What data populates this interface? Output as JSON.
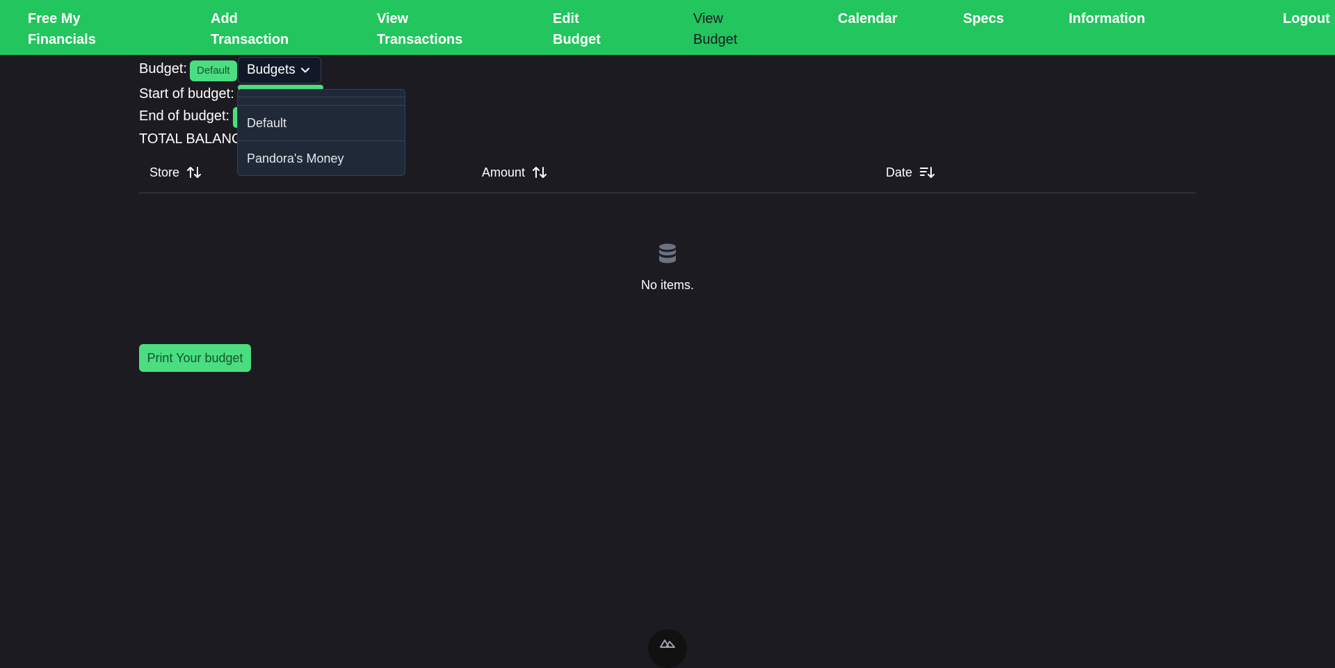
{
  "nav": {
    "brand": "Free My\nFinancials",
    "items": [
      "Add\nTransaction",
      "View\nTransactions",
      "Edit\nBudget",
      "View\nBudget",
      "Calendar",
      "Specs",
      "Information"
    ],
    "logout": "Logout"
  },
  "budget": {
    "label": "Budget:",
    "current": "Default",
    "dropdown_label": "Budgets",
    "options": [
      "Default",
      "Pandora's Money"
    ],
    "start_label": "Start of budget:",
    "end_label": "End of budget:",
    "total_label": "TOTAL BALANCE"
  },
  "table": {
    "headers": [
      "Store",
      "Amount",
      "Date"
    ],
    "empty_text": "No items."
  },
  "print_button": "Print Your budget",
  "colors": {
    "accent": "#22c55e",
    "button": "#4ade80",
    "background": "#1c1b22",
    "menu": "#1f2937"
  },
  "icons": {
    "sort": "sort-arrows-icon",
    "sort_desc": "sort-desc-icon",
    "empty": "database-icon",
    "chevron": "chevron-down-icon",
    "footer": "nuxt-logo-icon"
  }
}
